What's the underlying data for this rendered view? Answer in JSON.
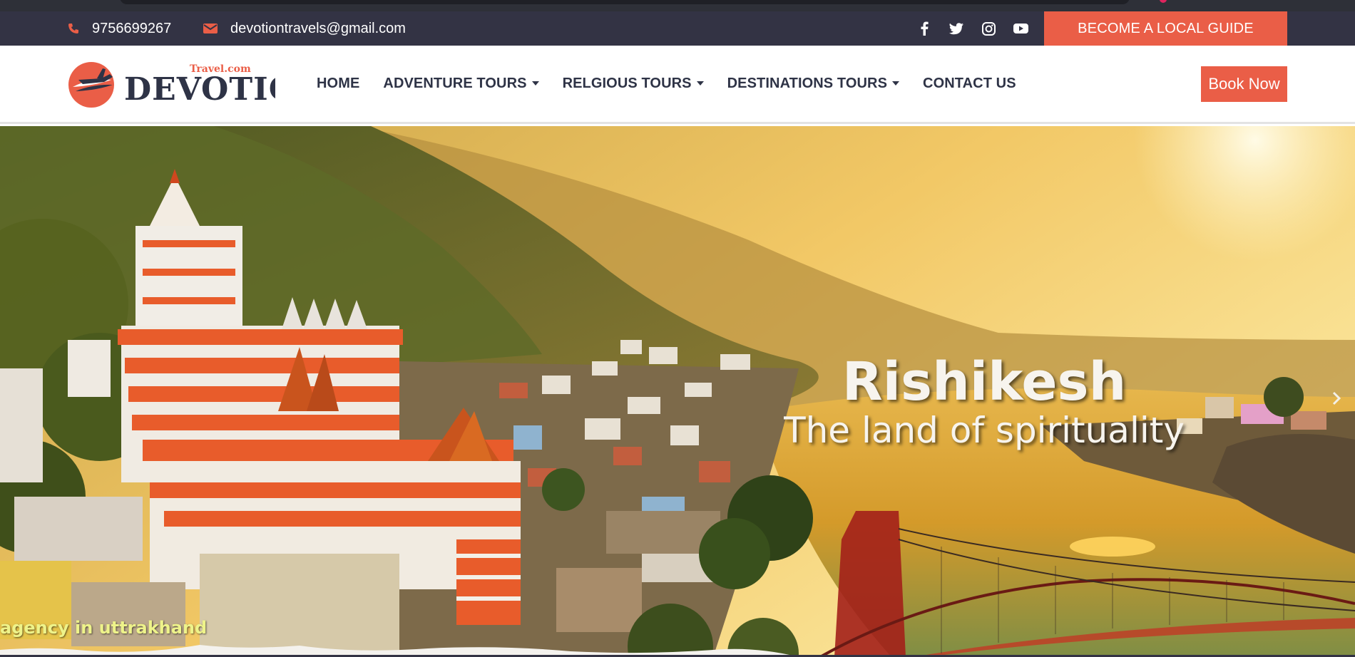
{
  "topbar": {
    "phone": "9756699267",
    "email": "devotiontravels@gmail.com",
    "social": [
      "facebook-icon",
      "twitter-icon",
      "instagram-icon",
      "youtube-icon"
    ],
    "guide_button": "BECOME A LOCAL GUIDE"
  },
  "logo": {
    "name": "DEVOTION",
    "sub": "Travel.com"
  },
  "nav": {
    "items": [
      {
        "label": "HOME",
        "dropdown": false
      },
      {
        "label": "ADVENTURE TOURS",
        "dropdown": true
      },
      {
        "label": "RELGIOUS TOURS",
        "dropdown": true
      },
      {
        "label": "DESTINATIONS TOURS",
        "dropdown": true
      },
      {
        "label": "CONTACT US",
        "dropdown": false
      }
    ],
    "book_button": "Book Now"
  },
  "hero": {
    "title": "Rishikesh",
    "subtitle": "The land of spirituality",
    "ticker": "agency in uttrakhand"
  },
  "colors": {
    "accent": "#ea5e47",
    "topbar": "#333344",
    "nav_text": "#2e3346"
  }
}
